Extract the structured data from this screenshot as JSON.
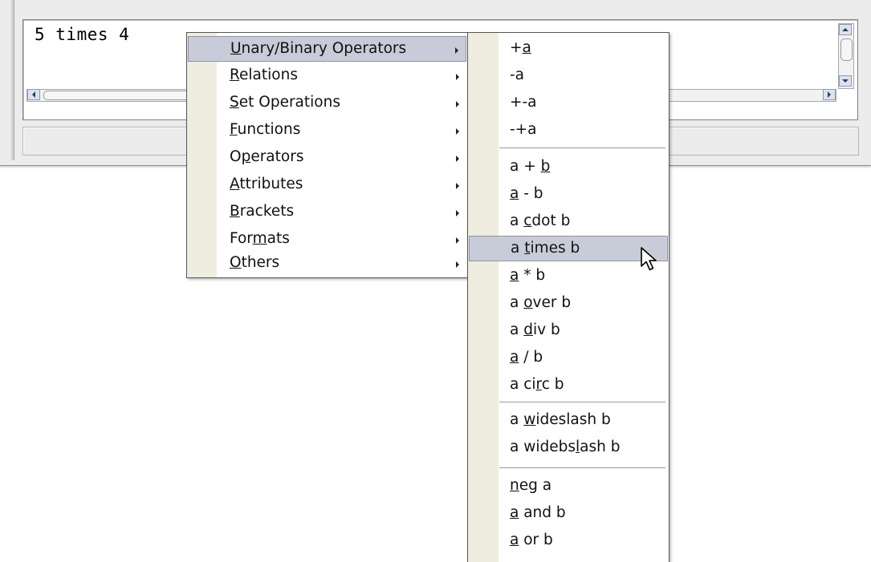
{
  "editor": {
    "command_text": "5 times 4"
  },
  "main_menu": {
    "items": [
      {
        "before": "",
        "key": "U",
        "after": "nary/Binary Operators"
      },
      {
        "before": "",
        "key": "R",
        "after": "elations"
      },
      {
        "before": "",
        "key": "S",
        "after": "et Operations"
      },
      {
        "before": "",
        "key": "F",
        "after": "unctions"
      },
      {
        "before": "O",
        "key": "p",
        "after": "erators"
      },
      {
        "before": "",
        "key": "A",
        "after": "ttributes"
      },
      {
        "before": "",
        "key": "B",
        "after": "rackets"
      },
      {
        "before": "For",
        "key": "m",
        "after": "ats"
      },
      {
        "before": "",
        "key": "O",
        "after": "thers"
      }
    ]
  },
  "sub_menu": {
    "items": [
      {
        "before": "+",
        "key": "a",
        "after": ""
      },
      {
        "before": "-a",
        "key": "",
        "after": ""
      },
      {
        "before": "+-a",
        "key": "",
        "after": ""
      },
      {
        "before": "-+a",
        "key": "",
        "after": ""
      },
      {
        "before": "a + ",
        "key": "b",
        "after": ""
      },
      {
        "before": "",
        "key": "a",
        "after": " - b"
      },
      {
        "before": "a ",
        "key": "c",
        "after": "dot b"
      },
      {
        "before": "a ",
        "key": "t",
        "after": "imes b"
      },
      {
        "before": "",
        "key": "a",
        "after": " * b"
      },
      {
        "before": "a ",
        "key": "o",
        "after": "ver b"
      },
      {
        "before": "a ",
        "key": "d",
        "after": "iv b"
      },
      {
        "before": "",
        "key": "a",
        "after": " / b"
      },
      {
        "before": "a ci",
        "key": "r",
        "after": "c b"
      },
      {
        "before": "a ",
        "key": "w",
        "after": "ideslash b"
      },
      {
        "before": "a widebs",
        "key": "l",
        "after": "ash b"
      },
      {
        "before": "",
        "key": "n",
        "after": "eg a"
      },
      {
        "before": "",
        "key": "a",
        "after": " and b"
      },
      {
        "before": "",
        "key": "a",
        "after": " or b"
      }
    ]
  },
  "colors": {
    "highlight": "#c8ccd9",
    "gutter": "#efeddf",
    "window": "#ececec"
  }
}
